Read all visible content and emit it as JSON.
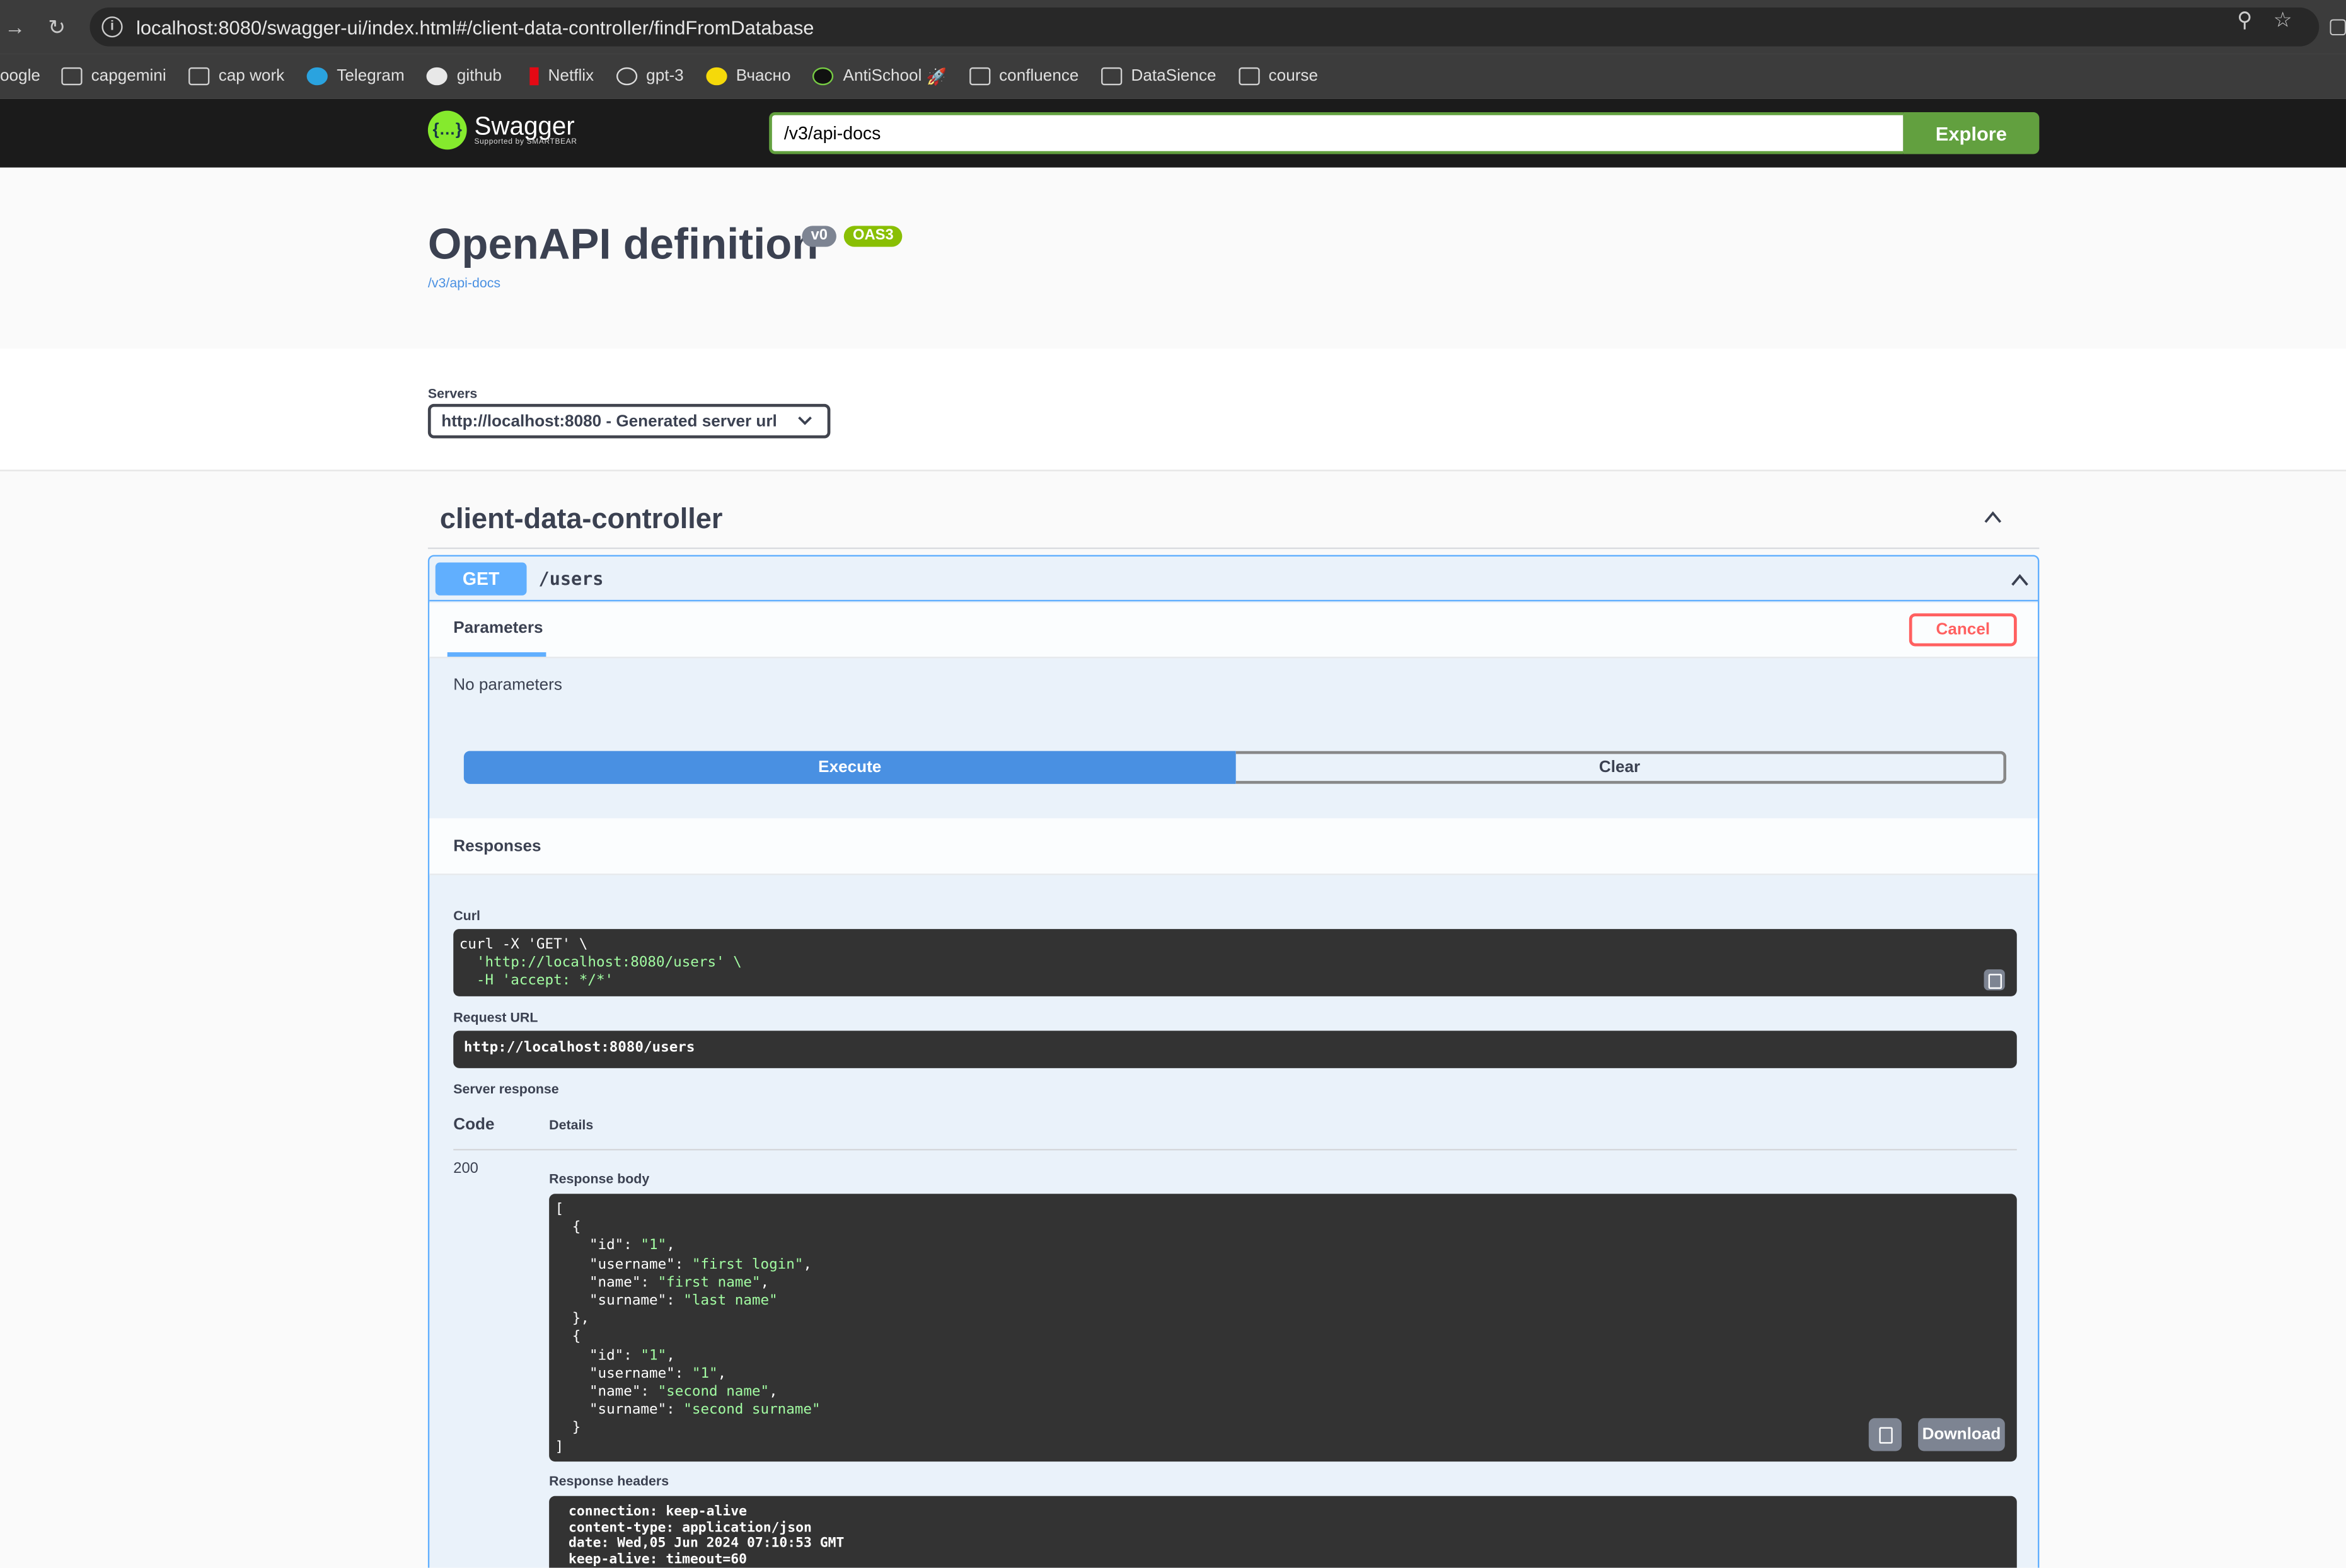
{
  "browser": {
    "url": "localhost:8080/swagger-ui/index.html#/client-data-controller/findFromDatabase",
    "bookmarks": [
      "oogle",
      "capgemini",
      "cap work",
      "Telegram",
      "github",
      "Netflix",
      "gpt-3",
      "Вчасно",
      "AntiSchool",
      "confluence",
      "DataSience",
      "course"
    ]
  },
  "topbar": {
    "logo_name": "Swagger",
    "logo_sub": "Supported by SMARTBEAR",
    "spec_input_value": "/v3/api-docs",
    "explore_label": "Explore"
  },
  "info": {
    "title": "OpenAPI definition",
    "version_badge": "v0",
    "oas_badge": "OAS3",
    "spec_link": "/v3/api-docs"
  },
  "servers": {
    "label": "Servers",
    "selected": "http://localhost:8080 - Generated server url"
  },
  "tag": {
    "name": "client-data-controller"
  },
  "operation": {
    "method": "GET",
    "path": "/users",
    "parameters_tab": "Parameters",
    "cancel_label": "Cancel",
    "no_params": "No parameters",
    "execute_label": "Execute",
    "clear_label": "Clear",
    "responses_title": "Responses",
    "curl_label": "Curl",
    "curl_lines": [
      "curl -X 'GET' \\",
      "  'http://localhost:8080/users' \\",
      "  -H 'accept: */*'"
    ],
    "request_url_label": "Request URL",
    "request_url": "http://localhost:8080/users",
    "server_response_label": "Server response",
    "code_header": "Code",
    "details_header": "Details",
    "status_code": "200",
    "response_body_label": "Response body",
    "response_body": [
      {
        "id": "1",
        "username": "first login",
        "name": "first name",
        "surname": "last name"
      },
      {
        "id": "1",
        "username": "1",
        "name": "second name",
        "surname": "second surname"
      }
    ],
    "download_label": "Download",
    "response_headers_label": "Response headers",
    "response_headers": [
      "connection: keep-alive",
      "content-type: application/json",
      "date: Wed,05 Jun 2024 07:10:53 GMT",
      "keep-alive: timeout=60"
    ]
  },
  "colors": {
    "get_blue": "#61affe",
    "execute_blue": "#4990e2",
    "explore_green": "#62a03f",
    "cancel_red": "#ff6060",
    "string_green": "#a2fca2"
  }
}
